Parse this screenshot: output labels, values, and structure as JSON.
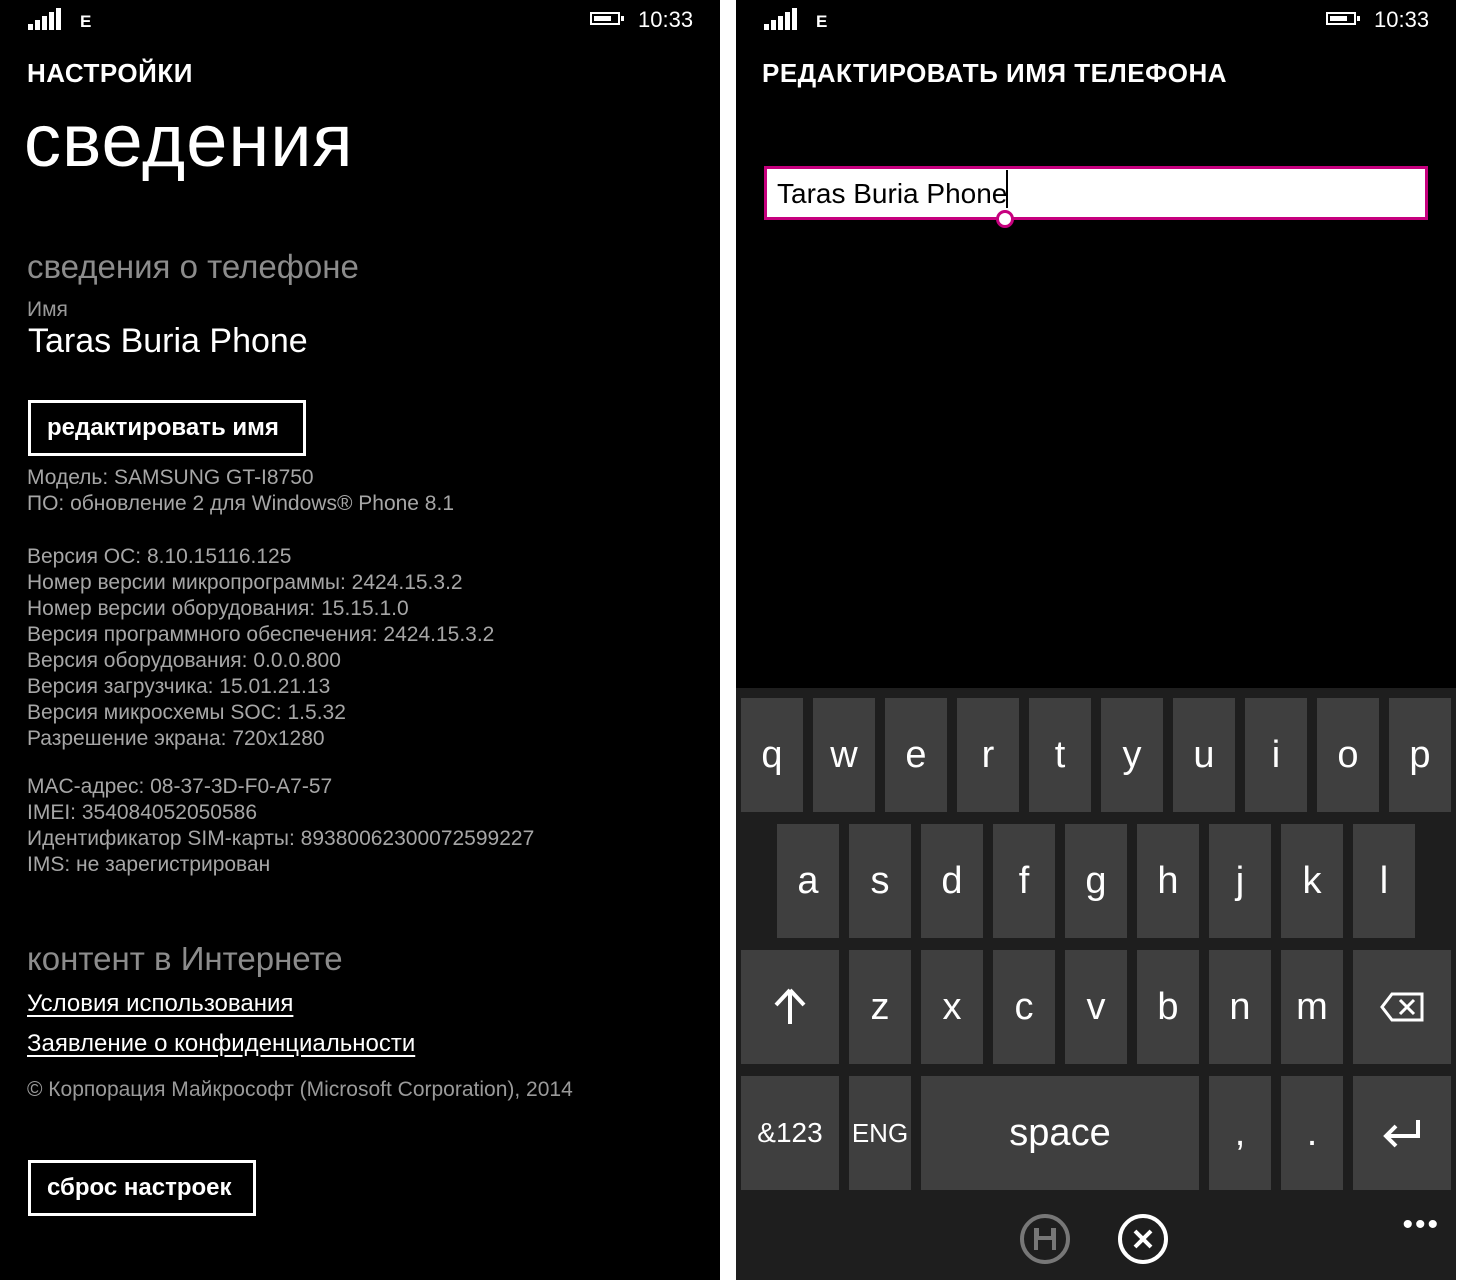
{
  "status": {
    "network": "E",
    "time": "10:33"
  },
  "settings": {
    "app_title": "НАСТРОЙКИ",
    "page_title": "сведения",
    "phone_section": "сведения о телефоне",
    "name_label": "Имя",
    "name_value": "Taras Buria Phone",
    "edit_name_button": "редактировать имя",
    "info_group_1": [
      "Модель: SAMSUNG GT-I8750",
      "ПО: обновление 2 для Windows® Phone 8.1"
    ],
    "info_group_2": [
      "Версия ОС: 8.10.15116.125",
      "Номер версии микропрограммы: 2424.15.3.2",
      "Номер версии оборудования: 15.15.1.0",
      "Версия программного обеспечения: 2424.15.3.2",
      "Версия оборудования: 0.0.0.800",
      "Версия загрузчика: 15.01.21.13",
      "Версия микросхемы SOC: 1.5.32",
      "Разрешение экрана: 720x1280"
    ],
    "info_group_3": [
      "MAC-адрес: 08-37-3D-F0-A7-57",
      "IMEI: 354084052050586",
      "Идентификатор SIM-карты: 89380062300072599227",
      "IMS: не зарегистрирован"
    ],
    "online_section": "контент в Интернете",
    "terms_link": "Условия использования",
    "privacy_link": "Заявление о конфиденциальности",
    "copyright": "© Корпорация Майкрософт (Microsoft Corporation), 2014",
    "reset_button": "сброс настроек"
  },
  "edit": {
    "title": "РЕДАКТИРОВАТЬ ИМЯ ТЕЛЕФОНА",
    "input_value": "Taras Buria Phone"
  },
  "keyboard": {
    "row1": [
      "q",
      "w",
      "e",
      "r",
      "t",
      "y",
      "u",
      "i",
      "o",
      "p"
    ],
    "row2": [
      "a",
      "s",
      "d",
      "f",
      "g",
      "h",
      "j",
      "k",
      "l"
    ],
    "row3": [
      "z",
      "x",
      "c",
      "v",
      "b",
      "n",
      "m"
    ],
    "shift": "🡡",
    "backspace": "⌫",
    "symbols": "&123",
    "lang": "ENG",
    "space": "space",
    "comma": ",",
    "period": ".",
    "enter": "↵"
  },
  "appbar": {
    "more": "•••"
  },
  "colors": {
    "accent": "#c6007e",
    "background": "#000000",
    "key": "#3f3f3f",
    "keyboard_bg": "#1e1e1e"
  },
  "icons": [
    "signal-icon",
    "battery-icon",
    "save-icon",
    "cancel-icon",
    "shift-icon",
    "backspace-icon",
    "enter-icon"
  ]
}
